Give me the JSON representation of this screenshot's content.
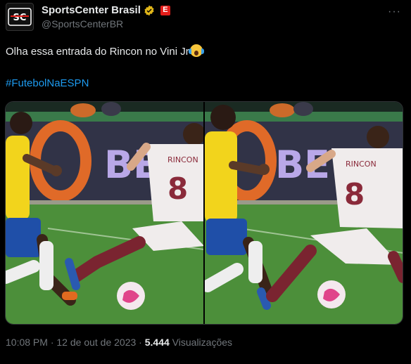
{
  "header": {
    "display_name": "SportsCenter Brasil",
    "handle": "@SportsCenterBR",
    "avatar_text": "SC",
    "badge_text": "E",
    "more_label": "···"
  },
  "tweet": {
    "text": "Olha essa entrada do Rincon no Vini Jr",
    "hashtag": "#FutebolNaESPN"
  },
  "media": {
    "board_text": "BET",
    "number_left": "8",
    "number_right": "8",
    "shirt_name": "RINCON"
  },
  "meta": {
    "time": "10:08 PM",
    "sep1": " · ",
    "date": "12 de out de 2023",
    "sep2": " · ",
    "views_count": "5.444",
    "views_label": " Visualizações"
  },
  "colors": {
    "link": "#1d9bf0",
    "verified": "#e2b719",
    "espn_red": "#e31d1a"
  }
}
